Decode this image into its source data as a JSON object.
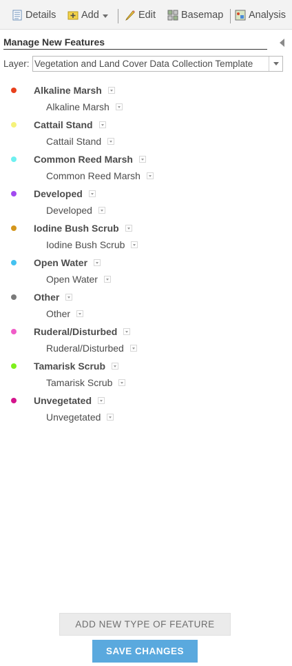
{
  "toolbar": {
    "details_label": "Details",
    "add_label": "Add",
    "edit_label": "Edit",
    "basemap_label": "Basemap",
    "analysis_label": "Analysis"
  },
  "panel": {
    "title": "Manage New Features",
    "layer_label": "Layer:",
    "layer_value": "Vegetation and Land Cover Data Collection Template"
  },
  "features": [
    {
      "name": "Alkaline Marsh",
      "sub": "Alkaline Marsh",
      "color": "#e8401c"
    },
    {
      "name": "Cattail Stand",
      "sub": "Cattail Stand",
      "color": "#f5f27a"
    },
    {
      "name": "Common Reed Marsh",
      "sub": "Common Reed Marsh",
      "color": "#6ef0f0"
    },
    {
      "name": "Developed",
      "sub": "Developed",
      "color": "#a24af0"
    },
    {
      "name": "Iodine Bush Scrub",
      "sub": "Iodine Bush Scrub",
      "color": "#d4961c"
    },
    {
      "name": "Open Water",
      "sub": "Open Water",
      "color": "#44c2f0"
    },
    {
      "name": "Other",
      "sub": "Other",
      "color": "#7a7a7a"
    },
    {
      "name": "Ruderal/Disturbed",
      "sub": "Ruderal/Disturbed",
      "color": "#f05cc8"
    },
    {
      "name": "Tamarisk Scrub",
      "sub": "Tamarisk Scrub",
      "color": "#7ef01c"
    },
    {
      "name": "Unvegetated",
      "sub": "Unvegetated",
      "color": "#d4148c"
    }
  ],
  "buttons": {
    "add_type": "ADD NEW TYPE OF FEATURE",
    "save": "SAVE CHANGES"
  }
}
